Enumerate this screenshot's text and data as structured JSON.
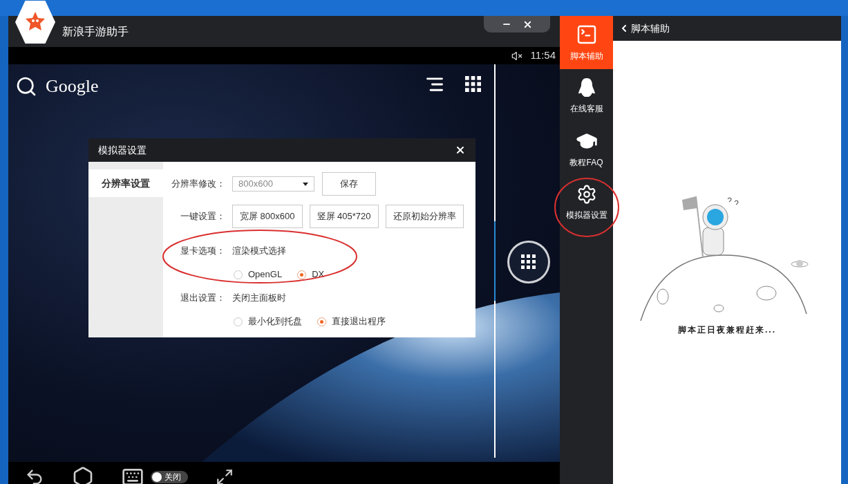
{
  "window": {
    "title": "新浪手游助手"
  },
  "status_bar": {
    "time": "11:54",
    "muted": true
  },
  "home_screen": {
    "search_label": "Google"
  },
  "dialog": {
    "title": "模拟器设置",
    "tabs": [
      {
        "label": "分辨率设置",
        "selected": true
      }
    ],
    "resolution": {
      "label": "分辨率修改：",
      "value": "800x600",
      "save": "保存"
    },
    "presets": {
      "label": "一键设置：",
      "buttons": [
        "宽屏 800x600",
        "竖屏 405*720",
        "还原初始分辨率"
      ]
    },
    "graphics": {
      "label": "显卡选项：",
      "description": "渲染模式选择",
      "options": [
        {
          "label": "OpenGL",
          "selected": false
        },
        {
          "label": "DX",
          "selected": true
        }
      ]
    },
    "exit": {
      "label": "退出设置：",
      "description": "关闭主面板时",
      "options": [
        {
          "label": "最小化到托盘",
          "selected": false
        },
        {
          "label": "直接退出程序",
          "selected": true
        }
      ]
    }
  },
  "bottom_bar": {
    "toggle": {
      "label": "关闭",
      "on": false
    }
  },
  "sidebar": {
    "items": [
      {
        "kind": "script",
        "label": "脚本辅助",
        "selected": true
      },
      {
        "kind": "support",
        "label": "在线客服",
        "selected": false
      },
      {
        "kind": "faq",
        "label": "教程FAQ",
        "selected": false
      },
      {
        "kind": "settings",
        "label": "模拟器设置",
        "selected": false
      }
    ]
  },
  "panel": {
    "title": "脚本辅助",
    "message": "脚本正日夜兼程赶来..."
  }
}
